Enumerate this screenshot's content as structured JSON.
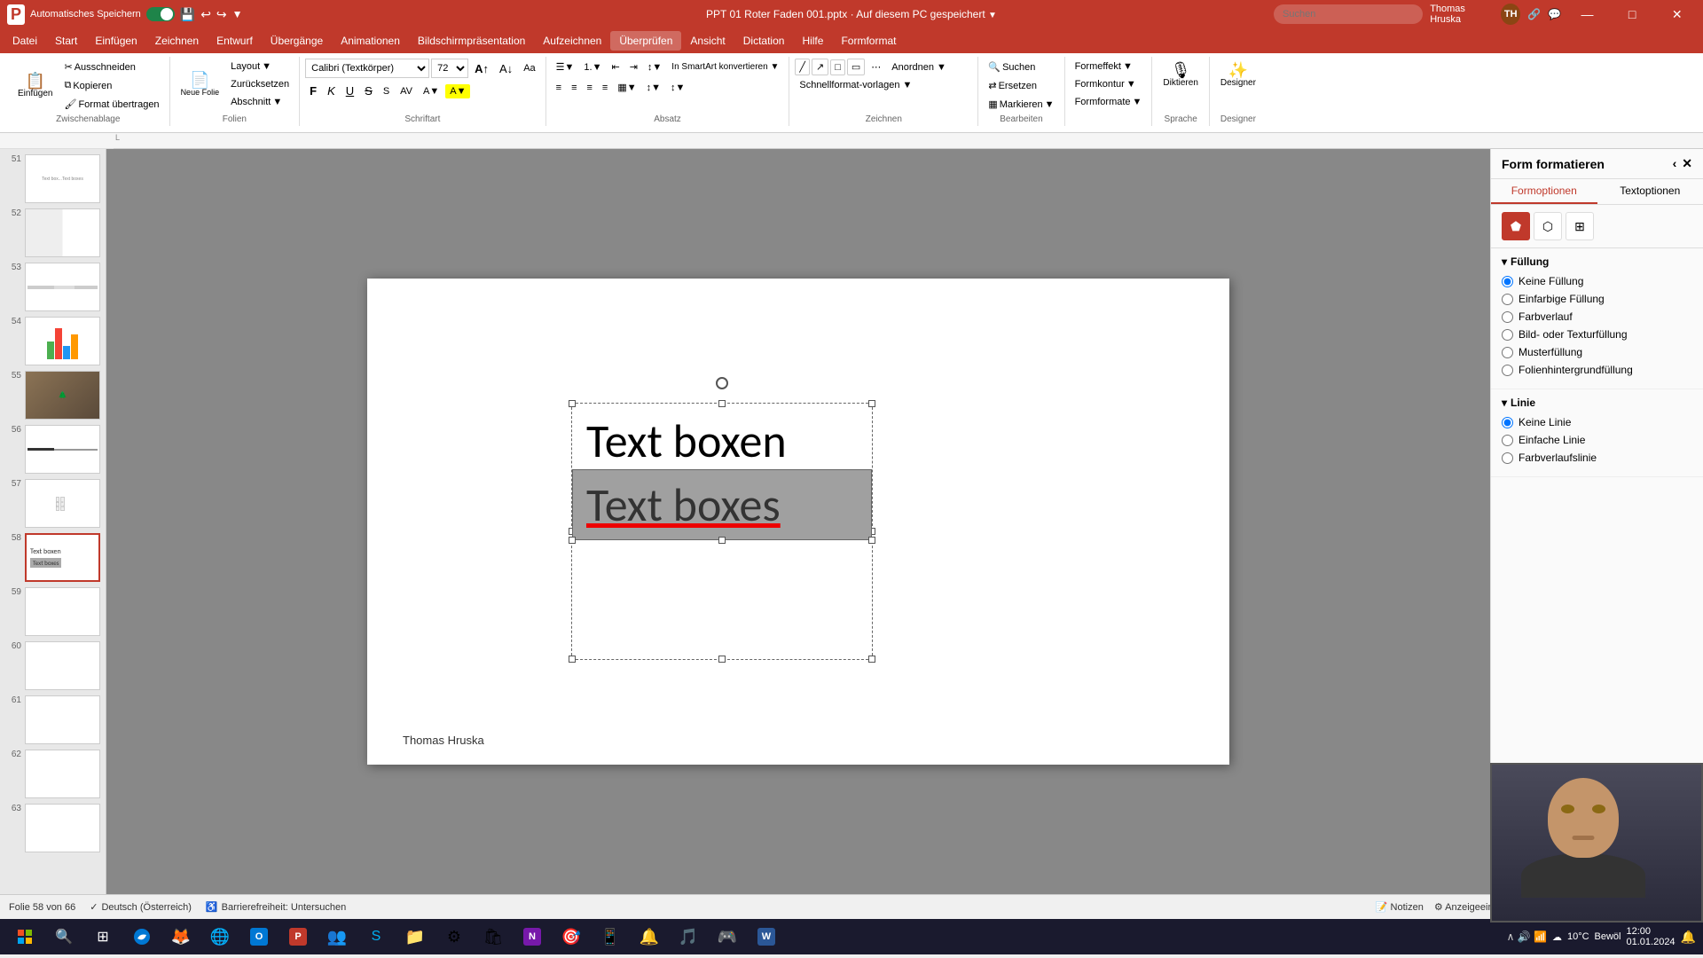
{
  "titlebar": {
    "autosave_label": "Automatisches Speichern",
    "file_name": "PPT 01 Roter Faden 001.pptx",
    "save_location": "Auf diesem PC gespeichert",
    "user_name": "Thomas Hruska",
    "search_placeholder": "Suchen",
    "minimize": "—",
    "maximize": "□",
    "close": "✕"
  },
  "menubar": {
    "items": [
      "Datei",
      "Start",
      "Einfügen",
      "Zeichnen",
      "Entwurf",
      "Übergänge",
      "Animationen",
      "Bildschirmpräsentation",
      "Aufzeichnen",
      "Überprüfen",
      "Ansicht",
      "Dictation",
      "Hilfe",
      "Formformat"
    ]
  },
  "ribbon": {
    "zwischenablage": {
      "label": "Zwischenablage",
      "paste_btn": "Einfügen",
      "cut_btn": "Ausschneiden",
      "copy_btn": "Kopieren",
      "format_btn": "Format übertragen"
    },
    "folien": {
      "label": "Folien",
      "new_slide": "Neue Folie",
      "layout": "Layout",
      "reset": "Zurücksetzen",
      "section": "Abschnitt"
    },
    "schriftart": {
      "label": "Schriftart",
      "font_name": "Calibri (Textkörper)",
      "font_size": "72"
    },
    "absatz": {
      "label": "Absatz"
    },
    "zeichnen": {
      "label": "Zeichnen"
    },
    "bearbeiten": {
      "label": "Bearbeiten",
      "suchen": "Suchen",
      "ersetzen": "Ersetzen",
      "markieren": "Markieren",
      "formeffekt": "Formeffekt",
      "formkontur": "Formkontur",
      "formformate": "Formformate"
    },
    "sprache": {
      "label": "Sprache",
      "diktieren": "Diktieren"
    },
    "designer": {
      "label": "Designer",
      "designer_btn": "Designer"
    }
  },
  "slide_panel": {
    "slides": [
      {
        "num": "51",
        "active": false
      },
      {
        "num": "52",
        "active": false
      },
      {
        "num": "53",
        "active": false
      },
      {
        "num": "54",
        "active": false
      },
      {
        "num": "55",
        "active": false
      },
      {
        "num": "56",
        "active": false
      },
      {
        "num": "57",
        "active": false
      },
      {
        "num": "58",
        "active": true
      },
      {
        "num": "59",
        "active": false
      },
      {
        "num": "60",
        "active": false
      },
      {
        "num": "61",
        "active": false
      },
      {
        "num": "62",
        "active": false
      },
      {
        "num": "63",
        "active": false
      }
    ]
  },
  "slide_content": {
    "text_top": "Text boxen",
    "text_bottom": "Text boxes",
    "author": "Thomas Hruska"
  },
  "right_panel": {
    "title": "Form formatieren",
    "tab_form": "Formoptionen",
    "tab_text": "Textoptionen",
    "section_fill": {
      "title": "Füllung",
      "options": [
        "Keine Füllung",
        "Einfarbige Füllung",
        "Farbverlauf",
        "Bild- oder Texturfüllung",
        "Musterfüllung",
        "Folienhintergrundfüllung"
      ]
    },
    "section_line": {
      "title": "Linie",
      "options": [
        "Keine Linie",
        "Einfache Linie",
        "Farbverlaufslinie"
      ]
    }
  },
  "statusbar": {
    "slide_info": "Folie 58 von 66",
    "language": "Deutsch (Österreich)",
    "accessibility": "Barrierefreiheit: Untersuchen",
    "notes": "Notizen",
    "settings": "Anzeigeeinstellungen"
  },
  "taskbar": {
    "weather": "10°C",
    "weather_label": "Bewöl"
  }
}
